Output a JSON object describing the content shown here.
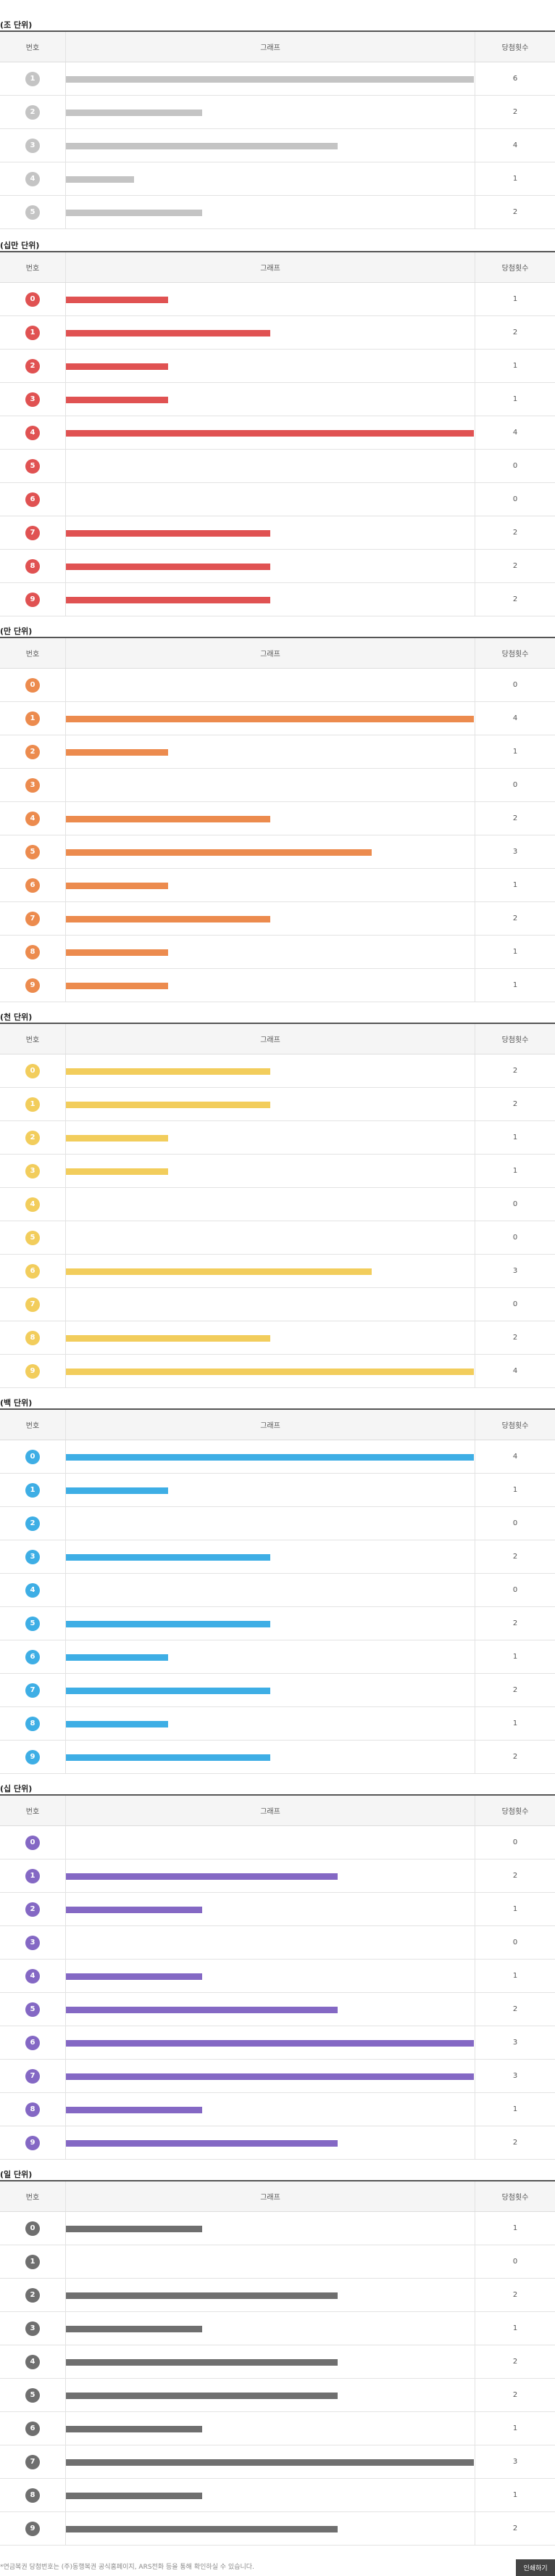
{
  "headers": {
    "num": "번호",
    "graph": "그래프",
    "count": "당첨횟수"
  },
  "footnote": "*연금복권 당첨번호는 (주)동행복권 공식홈페이지, ARS전화 등을 통해 확인하실 수 있습니다.",
  "print_label": "인쇄하기",
  "chart_data": [
    {
      "type": "bar",
      "title": "(조 단위)",
      "color": "#c4c4c4",
      "categories": [
        "1",
        "2",
        "3",
        "4",
        "5"
      ],
      "values": [
        6,
        2,
        4,
        1,
        2
      ]
    },
    {
      "type": "bar",
      "title": "(십만 단위)",
      "color": "#e05252",
      "categories": [
        "0",
        "1",
        "2",
        "3",
        "4",
        "5",
        "6",
        "7",
        "8",
        "9"
      ],
      "values": [
        1,
        2,
        1,
        1,
        4,
        0,
        0,
        2,
        2,
        2
      ]
    },
    {
      "type": "bar",
      "title": "(만 단위)",
      "color": "#ec8b4e",
      "categories": [
        "0",
        "1",
        "2",
        "3",
        "4",
        "5",
        "6",
        "7",
        "8",
        "9"
      ],
      "values": [
        0,
        4,
        1,
        0,
        2,
        3,
        1,
        2,
        1,
        1
      ]
    },
    {
      "type": "bar",
      "title": "(천 단위)",
      "color": "#f2cd5c",
      "categories": [
        "0",
        "1",
        "2",
        "3",
        "4",
        "5",
        "6",
        "7",
        "8",
        "9"
      ],
      "values": [
        2,
        2,
        1,
        1,
        0,
        0,
        3,
        0,
        2,
        4
      ]
    },
    {
      "type": "bar",
      "title": "(백 단위)",
      "color": "#3eaee5",
      "categories": [
        "0",
        "1",
        "2",
        "3",
        "4",
        "5",
        "6",
        "7",
        "8",
        "9"
      ],
      "values": [
        4,
        1,
        0,
        2,
        0,
        2,
        1,
        2,
        1,
        2
      ]
    },
    {
      "type": "bar",
      "title": "(십 단위)",
      "color": "#8468c4",
      "categories": [
        "0",
        "1",
        "2",
        "3",
        "4",
        "5",
        "6",
        "7",
        "8",
        "9"
      ],
      "values": [
        0,
        2,
        1,
        0,
        1,
        2,
        3,
        3,
        1,
        2
      ]
    },
    {
      "type": "bar",
      "title": "(일 단위)",
      "color": "#6f6f6f",
      "categories": [
        "0",
        "1",
        "2",
        "3",
        "4",
        "5",
        "6",
        "7",
        "8",
        "9"
      ],
      "values": [
        1,
        0,
        2,
        1,
        2,
        2,
        1,
        3,
        1,
        2
      ]
    }
  ]
}
